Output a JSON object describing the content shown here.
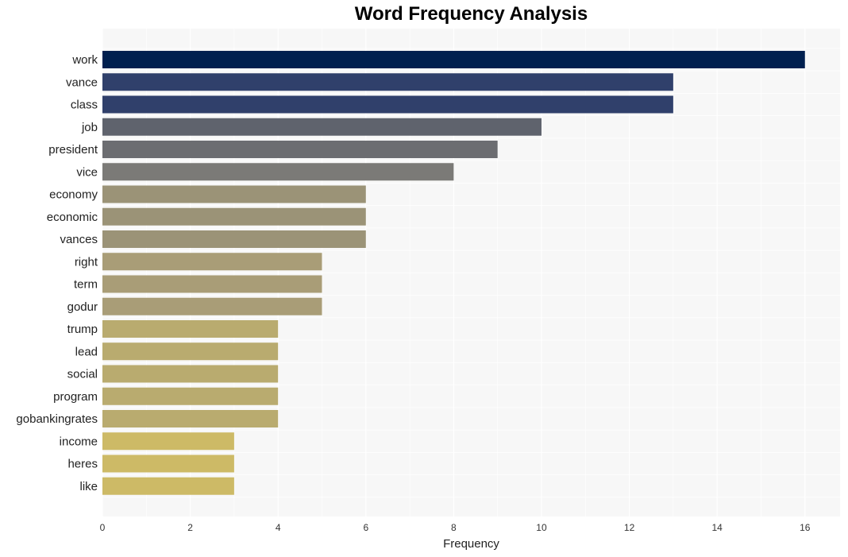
{
  "chart_data": {
    "type": "bar",
    "orientation": "horizontal",
    "title": "Word Frequency Analysis",
    "xlabel": "Frequency",
    "ylabel": "",
    "xlim": [
      0,
      16.8
    ],
    "xticks": [
      0,
      2,
      4,
      6,
      8,
      10,
      12,
      14,
      16
    ],
    "grid": true,
    "categories": [
      "work",
      "vance",
      "class",
      "job",
      "president",
      "vice",
      "economy",
      "economic",
      "vances",
      "right",
      "term",
      "godur",
      "trump",
      "lead",
      "social",
      "program",
      "gobankingrates",
      "income",
      "heres",
      "like"
    ],
    "values": [
      16,
      13,
      13,
      10,
      9,
      8,
      6,
      6,
      6,
      5,
      5,
      5,
      4,
      4,
      4,
      4,
      4,
      3,
      3,
      3
    ],
    "colors": [
      "#00204f",
      "#30406b",
      "#30406b",
      "#5f636d",
      "#6c6d71",
      "#7b7a77",
      "#9b9377",
      "#9b9377",
      "#9b9377",
      "#a99d77",
      "#a99d77",
      "#a99d77",
      "#b9ab6f",
      "#b9ab6f",
      "#b9ab6f",
      "#b9ab6f",
      "#b9ab6f",
      "#cdba66",
      "#cdba66",
      "#cdba66"
    ]
  },
  "style": {
    "plot_background": "#f7f7f7",
    "grid_color": "#ffffff"
  }
}
